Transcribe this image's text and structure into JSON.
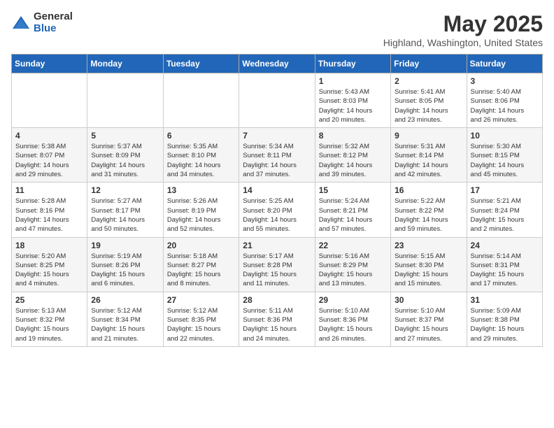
{
  "header": {
    "logo_general": "General",
    "logo_blue": "Blue",
    "month_title": "May 2025",
    "location": "Highland, Washington, United States"
  },
  "weekdays": [
    "Sunday",
    "Monday",
    "Tuesday",
    "Wednesday",
    "Thursday",
    "Friday",
    "Saturday"
  ],
  "weeks": [
    [
      {
        "day": "",
        "info": ""
      },
      {
        "day": "",
        "info": ""
      },
      {
        "day": "",
        "info": ""
      },
      {
        "day": "",
        "info": ""
      },
      {
        "day": "1",
        "info": "Sunrise: 5:43 AM\nSunset: 8:03 PM\nDaylight: 14 hours\nand 20 minutes."
      },
      {
        "day": "2",
        "info": "Sunrise: 5:41 AM\nSunset: 8:05 PM\nDaylight: 14 hours\nand 23 minutes."
      },
      {
        "day": "3",
        "info": "Sunrise: 5:40 AM\nSunset: 8:06 PM\nDaylight: 14 hours\nand 26 minutes."
      }
    ],
    [
      {
        "day": "4",
        "info": "Sunrise: 5:38 AM\nSunset: 8:07 PM\nDaylight: 14 hours\nand 29 minutes."
      },
      {
        "day": "5",
        "info": "Sunrise: 5:37 AM\nSunset: 8:09 PM\nDaylight: 14 hours\nand 31 minutes."
      },
      {
        "day": "6",
        "info": "Sunrise: 5:35 AM\nSunset: 8:10 PM\nDaylight: 14 hours\nand 34 minutes."
      },
      {
        "day": "7",
        "info": "Sunrise: 5:34 AM\nSunset: 8:11 PM\nDaylight: 14 hours\nand 37 minutes."
      },
      {
        "day": "8",
        "info": "Sunrise: 5:32 AM\nSunset: 8:12 PM\nDaylight: 14 hours\nand 39 minutes."
      },
      {
        "day": "9",
        "info": "Sunrise: 5:31 AM\nSunset: 8:14 PM\nDaylight: 14 hours\nand 42 minutes."
      },
      {
        "day": "10",
        "info": "Sunrise: 5:30 AM\nSunset: 8:15 PM\nDaylight: 14 hours\nand 45 minutes."
      }
    ],
    [
      {
        "day": "11",
        "info": "Sunrise: 5:28 AM\nSunset: 8:16 PM\nDaylight: 14 hours\nand 47 minutes."
      },
      {
        "day": "12",
        "info": "Sunrise: 5:27 AM\nSunset: 8:17 PM\nDaylight: 14 hours\nand 50 minutes."
      },
      {
        "day": "13",
        "info": "Sunrise: 5:26 AM\nSunset: 8:19 PM\nDaylight: 14 hours\nand 52 minutes."
      },
      {
        "day": "14",
        "info": "Sunrise: 5:25 AM\nSunset: 8:20 PM\nDaylight: 14 hours\nand 55 minutes."
      },
      {
        "day": "15",
        "info": "Sunrise: 5:24 AM\nSunset: 8:21 PM\nDaylight: 14 hours\nand 57 minutes."
      },
      {
        "day": "16",
        "info": "Sunrise: 5:22 AM\nSunset: 8:22 PM\nDaylight: 14 hours\nand 59 minutes."
      },
      {
        "day": "17",
        "info": "Sunrise: 5:21 AM\nSunset: 8:24 PM\nDaylight: 15 hours\nand 2 minutes."
      }
    ],
    [
      {
        "day": "18",
        "info": "Sunrise: 5:20 AM\nSunset: 8:25 PM\nDaylight: 15 hours\nand 4 minutes."
      },
      {
        "day": "19",
        "info": "Sunrise: 5:19 AM\nSunset: 8:26 PM\nDaylight: 15 hours\nand 6 minutes."
      },
      {
        "day": "20",
        "info": "Sunrise: 5:18 AM\nSunset: 8:27 PM\nDaylight: 15 hours\nand 8 minutes."
      },
      {
        "day": "21",
        "info": "Sunrise: 5:17 AM\nSunset: 8:28 PM\nDaylight: 15 hours\nand 11 minutes."
      },
      {
        "day": "22",
        "info": "Sunrise: 5:16 AM\nSunset: 8:29 PM\nDaylight: 15 hours\nand 13 minutes."
      },
      {
        "day": "23",
        "info": "Sunrise: 5:15 AM\nSunset: 8:30 PM\nDaylight: 15 hours\nand 15 minutes."
      },
      {
        "day": "24",
        "info": "Sunrise: 5:14 AM\nSunset: 8:31 PM\nDaylight: 15 hours\nand 17 minutes."
      }
    ],
    [
      {
        "day": "25",
        "info": "Sunrise: 5:13 AM\nSunset: 8:32 PM\nDaylight: 15 hours\nand 19 minutes."
      },
      {
        "day": "26",
        "info": "Sunrise: 5:12 AM\nSunset: 8:34 PM\nDaylight: 15 hours\nand 21 minutes."
      },
      {
        "day": "27",
        "info": "Sunrise: 5:12 AM\nSunset: 8:35 PM\nDaylight: 15 hours\nand 22 minutes."
      },
      {
        "day": "28",
        "info": "Sunrise: 5:11 AM\nSunset: 8:36 PM\nDaylight: 15 hours\nand 24 minutes."
      },
      {
        "day": "29",
        "info": "Sunrise: 5:10 AM\nSunset: 8:36 PM\nDaylight: 15 hours\nand 26 minutes."
      },
      {
        "day": "30",
        "info": "Sunrise: 5:10 AM\nSunset: 8:37 PM\nDaylight: 15 hours\nand 27 minutes."
      },
      {
        "day": "31",
        "info": "Sunrise: 5:09 AM\nSunset: 8:38 PM\nDaylight: 15 hours\nand 29 minutes."
      }
    ]
  ]
}
